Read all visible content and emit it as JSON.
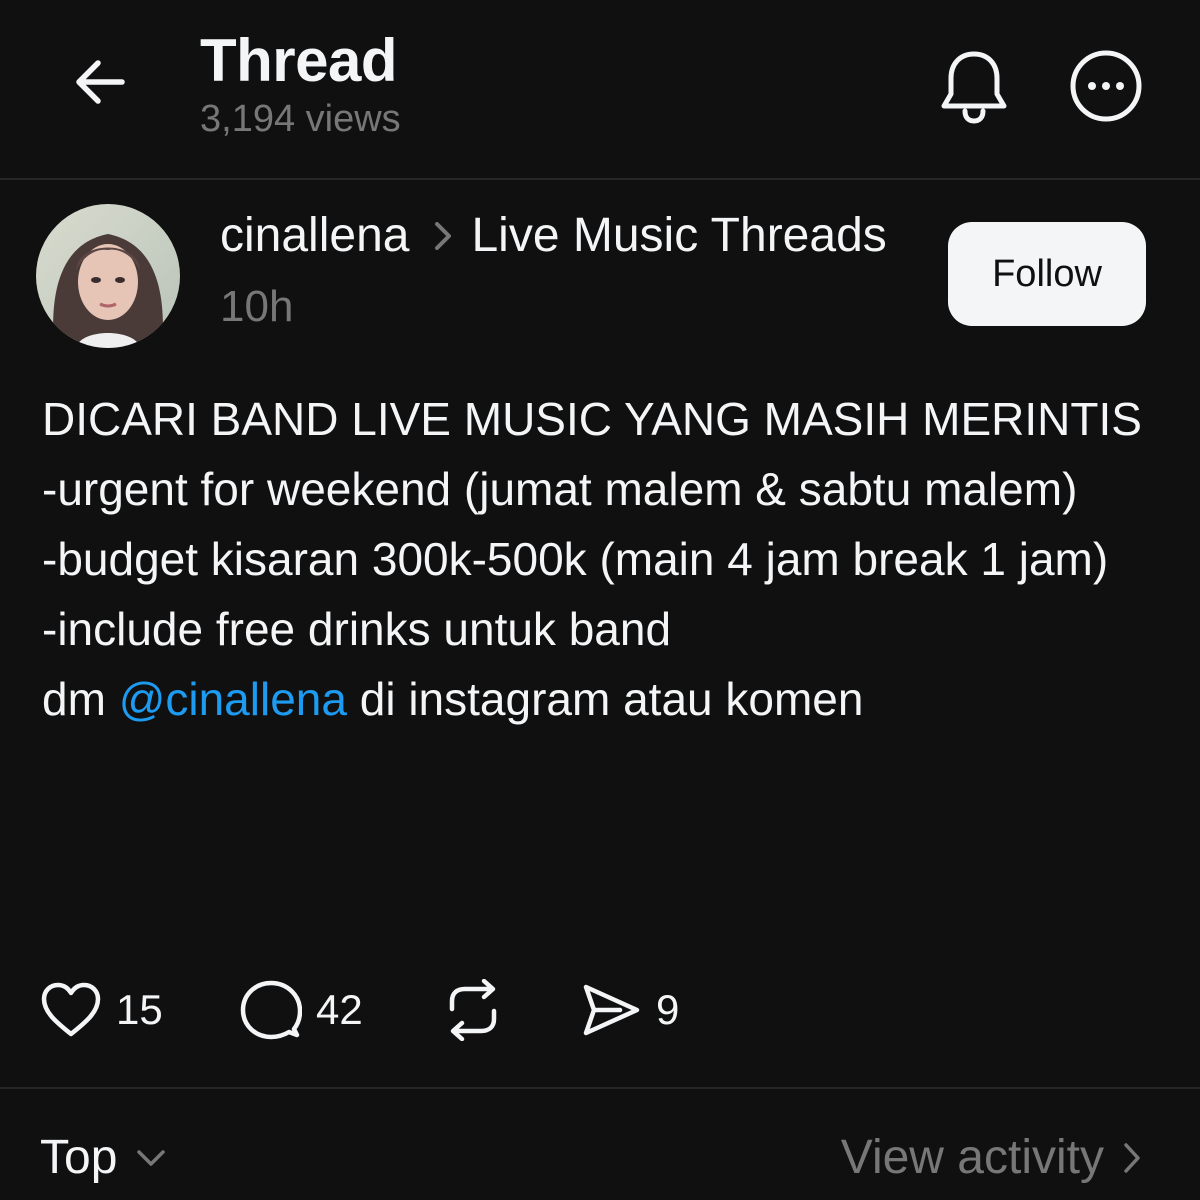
{
  "header": {
    "title": "Thread",
    "views": "3,194 views",
    "back_icon": "arrow-left-icon",
    "bell_icon": "bell-icon",
    "more_icon": "more-horizontal-icon"
  },
  "post": {
    "author": "cinallena",
    "community": "Live Music Threads",
    "time": "10h",
    "follow_label": "Follow",
    "lines": [
      "DICARI BAND LIVE MUSIC YANG MASIH MERINTIS",
      "-urgent for weekend (jumat malem & sabtu malem)",
      "-budget kisaran 300k-500k (main 4 jam break 1 jam)",
      "-include free drinks untuk band"
    ],
    "last_line": {
      "prefix": "dm ",
      "mention": "@cinallena",
      "suffix": " di instagram atau komen"
    },
    "mention_color": "#1d9bf0"
  },
  "actions": {
    "likes": "15",
    "replies": "42",
    "shares": "9"
  },
  "footer": {
    "sort_label": "Top",
    "activity_label": "View activity"
  }
}
